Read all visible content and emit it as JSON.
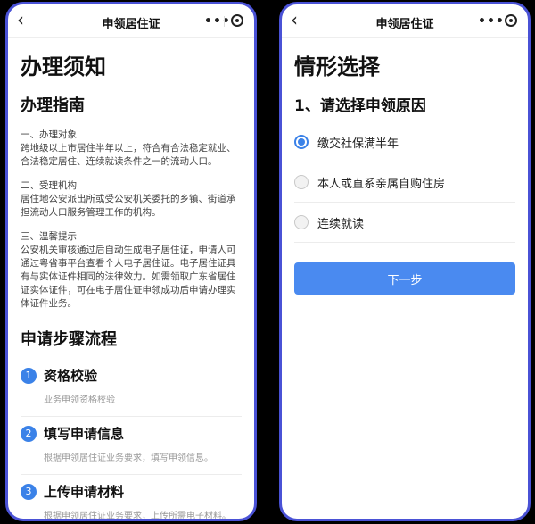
{
  "left": {
    "nav": {
      "back": "‹",
      "title": "申领居住证",
      "more": "•••"
    },
    "page_title": "办理须知",
    "guide": {
      "title": "办理指南",
      "sections": [
        {
          "title": "一、办理对象",
          "body": "跨地级以上市居住半年以上，符合有合法稳定就业、合法稳定居住、连续就读条件之一的流动人口。"
        },
        {
          "title": "二、受理机构",
          "body": "居住地公安派出所或受公安机关委托的乡镇、街道承担流动人口服务管理工作的机构。"
        },
        {
          "title": "三、温馨提示",
          "body": "公安机关审核通过后自动生成电子居住证，申请人可通过粤省事平台查看个人电子居住证。电子居住证具有与实体证件相同的法律效力。如需领取广东省居住证实体证件，可在电子居住证申领成功后申请办理实体证件业务。"
        }
      ]
    },
    "steps": {
      "title": "申请步骤流程",
      "items": [
        {
          "num": "1",
          "title": "资格校验",
          "desc": "业务申领资格校验"
        },
        {
          "num": "2",
          "title": "填写申请信息",
          "desc": "根据申领居住证业务要求，填写申领信息。"
        },
        {
          "num": "3",
          "title": "上传申请材料",
          "desc": "根据申领居住证业务要求，上传所需电子材料。"
        }
      ]
    }
  },
  "right": {
    "nav": {
      "back": "‹",
      "title": "申领居住证",
      "more": "•••"
    },
    "page_title": "情形选择",
    "question": "1、请选择申领原因",
    "options": [
      {
        "label": "缴交社保满半年",
        "checked": true
      },
      {
        "label": "本人或直系亲属自购住房",
        "checked": false
      },
      {
        "label": "连续就读",
        "checked": false
      }
    ],
    "next_label": "下一步"
  },
  "colors": {
    "accent": "#3b82e8",
    "button": "#4a8af0",
    "phone_border": "#4a52d6"
  }
}
